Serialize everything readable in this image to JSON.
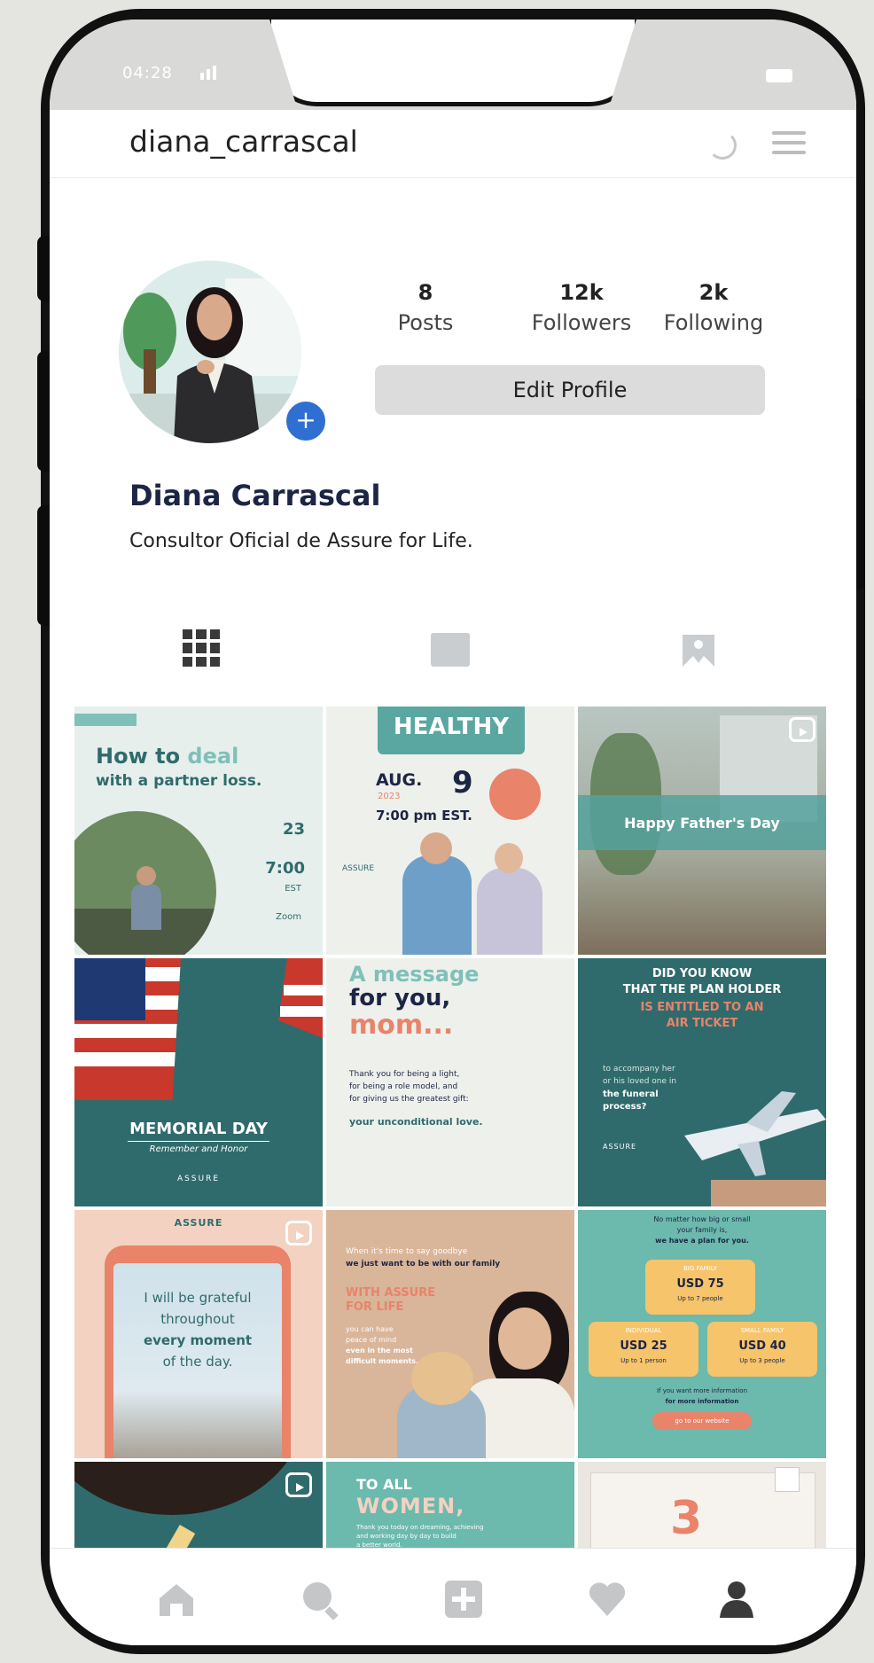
{
  "status": {
    "time": "04:28"
  },
  "header": {
    "username": "diana_carrascal"
  },
  "profile": {
    "posts_count": "8",
    "posts_label": "Posts",
    "followers_count": "12k",
    "followers_label": "Followers",
    "following_count": "2k",
    "following_label": "Following",
    "edit_label": "Edit Profile",
    "display_name": "Diana Carrascal",
    "bio": "Consultor Oficial de Assure for Life."
  },
  "posts": [
    {
      "tag": "",
      "title_a": "How to ",
      "title_b": "deal",
      "subtitle": "with a partner loss.",
      "date": "23",
      "time": "7:00",
      "zone": "EST",
      "platform": "Zoom"
    },
    {
      "title": "HEALTHY",
      "month": "AUG.",
      "day": "9",
      "year": "2023",
      "time": "7:00 pm EST.",
      "brand": "ASSURE"
    },
    {
      "title": "Happy Father's Day"
    },
    {
      "title": "MEMORIAL DAY",
      "subtitle": "Remember and Honor",
      "brand": "ASSURE"
    },
    {
      "line1": "A message",
      "line2": "for you,",
      "line3": "mom...",
      "body1": "Thank you for being a light,",
      "body2": "for being a role model, and",
      "body3": "for giving us the greatest gift:",
      "highlight": "your unconditional love."
    },
    {
      "line1": "DID YOU KNOW",
      "line2": "THAT THE PLAN HOLDER",
      "line3": "IS ENTITLED TO AN",
      "line4": "AIR TICKET",
      "body1": "to accompany her",
      "body2": "or his loved one in",
      "body3": "the funeral",
      "body4": "process?",
      "brand": "ASSURE"
    },
    {
      "brand": "ASSURE",
      "line1": "I will be grateful",
      "line2": "throughout",
      "line3": "every moment",
      "line4": "of the day."
    },
    {
      "line1": "When it's time to say goodbye",
      "line2": "we just want to be with our family",
      "line3": "WITH ASSURE",
      "line4": "FOR LIFE",
      "body1": "you can have",
      "body2": "peace of mind",
      "body3": "even in the most",
      "body4": "difficult moments."
    },
    {
      "head1": "No matter how big or small",
      "head2": "your family is,",
      "head3": "we have a plan for you.",
      "plan1_name": "BIG FAMILY",
      "plan1_price": "USD 75",
      "plan1_note": "Up to 7 people",
      "plan2_name": "INDIVIDUAL",
      "plan2_price": "USD 25",
      "plan2_note": "Up to 1 person",
      "plan3_name": "SMALL FAMILY",
      "plan3_price": "USD 40",
      "plan3_note": "Up to 3 people",
      "foot1": "If you want more information",
      "foot2": "for more information",
      "button": "go to our website"
    },
    {
      "title": ""
    },
    {
      "line1": "TO ALL",
      "line2": "WOMEN,",
      "body1": "Thank you today on dreaming, achieving",
      "body2": "and working day by day to build",
      "body3": "a better world."
    },
    {
      "number": "3"
    }
  ],
  "colors": {
    "teal": "#2f6b6c",
    "teal_light": "#6cb9ad",
    "salmon": "#e9836a",
    "navy": "#1d2545",
    "badge_blue": "#2f6fd1"
  }
}
